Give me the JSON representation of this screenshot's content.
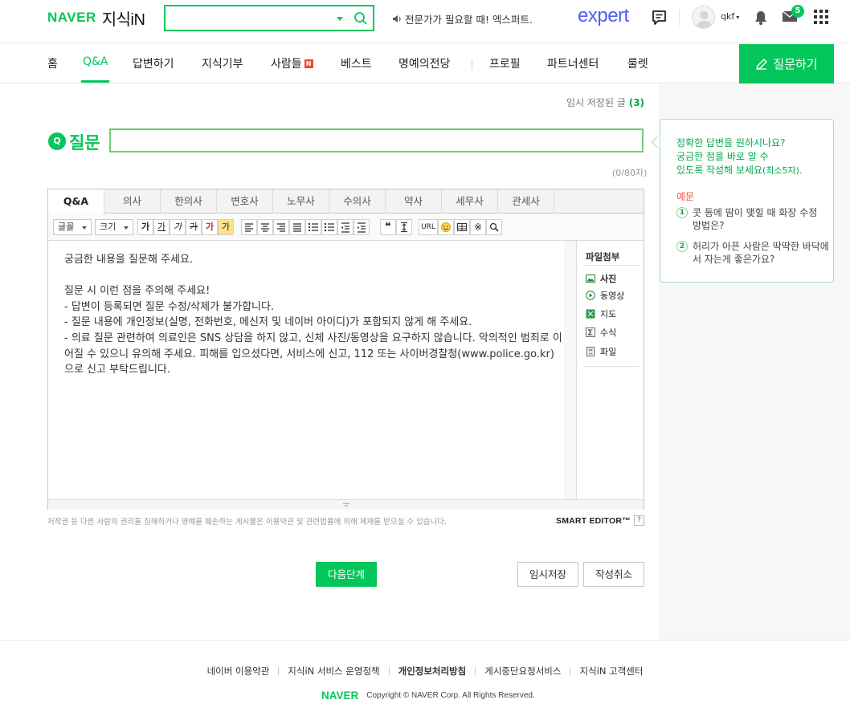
{
  "header": {
    "logo_naver": "NAVER",
    "logo_kin": "지식iN",
    "search_value": "",
    "promo_text": "전문가가 필요할 때! 엑스퍼트.",
    "expert_logo": "expert",
    "username": "qkf",
    "mail_count": "5"
  },
  "nav": {
    "items": [
      "홈",
      "Q&A",
      "답변하기",
      "지식기부",
      "사람들",
      "베스트",
      "명예의전당",
      "프로필",
      "파트너센터",
      "룰렛"
    ],
    "new_badge": "N",
    "active": "Q&A",
    "ask_button": "질문하기"
  },
  "form": {
    "draft_label": "임시 저장된 글",
    "draft_count": "(3)",
    "question_badge": "Q",
    "question_label": "질문",
    "title_value": "",
    "char_count": "(0/80자)"
  },
  "editor": {
    "tabs": [
      "Q&A",
      "의사",
      "한의사",
      "변호사",
      "노무사",
      "수의사",
      "약사",
      "세무사",
      "관세사"
    ],
    "active_tab": "Q&A",
    "font_select": "글꼴",
    "size_select": "크기",
    "tool_labels": [
      "가",
      "가",
      "가",
      "가",
      "가",
      "가"
    ],
    "url_label": "URL",
    "body_lines": [
      "궁금한 내용을 질문해 주세요.",
      "",
      "질문 시 이런 점을 주의해 주세요!",
      "- 답변이 등록되면 질문 수정/삭제가 불가합니다.",
      "- 질문 내용에 개인정보(실명, 전화번호, 메신저 및 네이버 아이디)가 포함되지 않게 해 주세요.",
      "- 의료 질문 관련하여 의료인은 SNS 상담을 하지 않고, 신체 사진/동영상을 요구하지 않습니다. 악의적인 범죄로 이어질 수 있으니 유의해 주세요. 피해를 입으셨다면, 서비스에 신고, 112 또는 사이버경찰청(www.police.go.kr)으로 신고 부탁드립니다."
    ],
    "attach_title": "파일첨부",
    "attach_items": [
      "사진",
      "동영상",
      "지도",
      "수식",
      "파일"
    ],
    "notice": "저작권 등 다른 사람의 권리를 침해하거나 명예를 훼손하는 게시물은 이용약관 및 관련법률에 의해 제재를 받으실 수 있습니다.",
    "smart_editor": "SMART EDITOR™",
    "help": "?"
  },
  "buttons": {
    "next": "다음단계",
    "temp_save": "임시저장",
    "cancel": "작성취소"
  },
  "tip": {
    "line1": "정확한 답변을 원하시나요?",
    "line2": "궁금한 점을 바로 알 수",
    "line3": "있도록 작성해 보세요",
    "line3_small": "(최소5자).",
    "example_label": "예문",
    "examples": [
      {
        "num": "1",
        "text": "콧 등에 땀이 맺힐 때 화장 수정 방법은?"
      },
      {
        "num": "2",
        "text": "허리가 아픈 사람은 딱딱한 바닥에서 자는게 좋은가요?"
      }
    ]
  },
  "footer": {
    "links": [
      "네이버 이용약관",
      "지식iN 서비스 운영정책",
      "개인정보처리방침",
      "게시중단요청서비스",
      "지식iN 고객센터"
    ],
    "logo": "NAVER",
    "copyright": "Copyright © NAVER Corp. All Rights Reserved."
  },
  "colors": {
    "brand": "#03c75a",
    "expert": "#4a5ff2",
    "new_badge": "#f04438",
    "example_label": "#f0563c"
  }
}
